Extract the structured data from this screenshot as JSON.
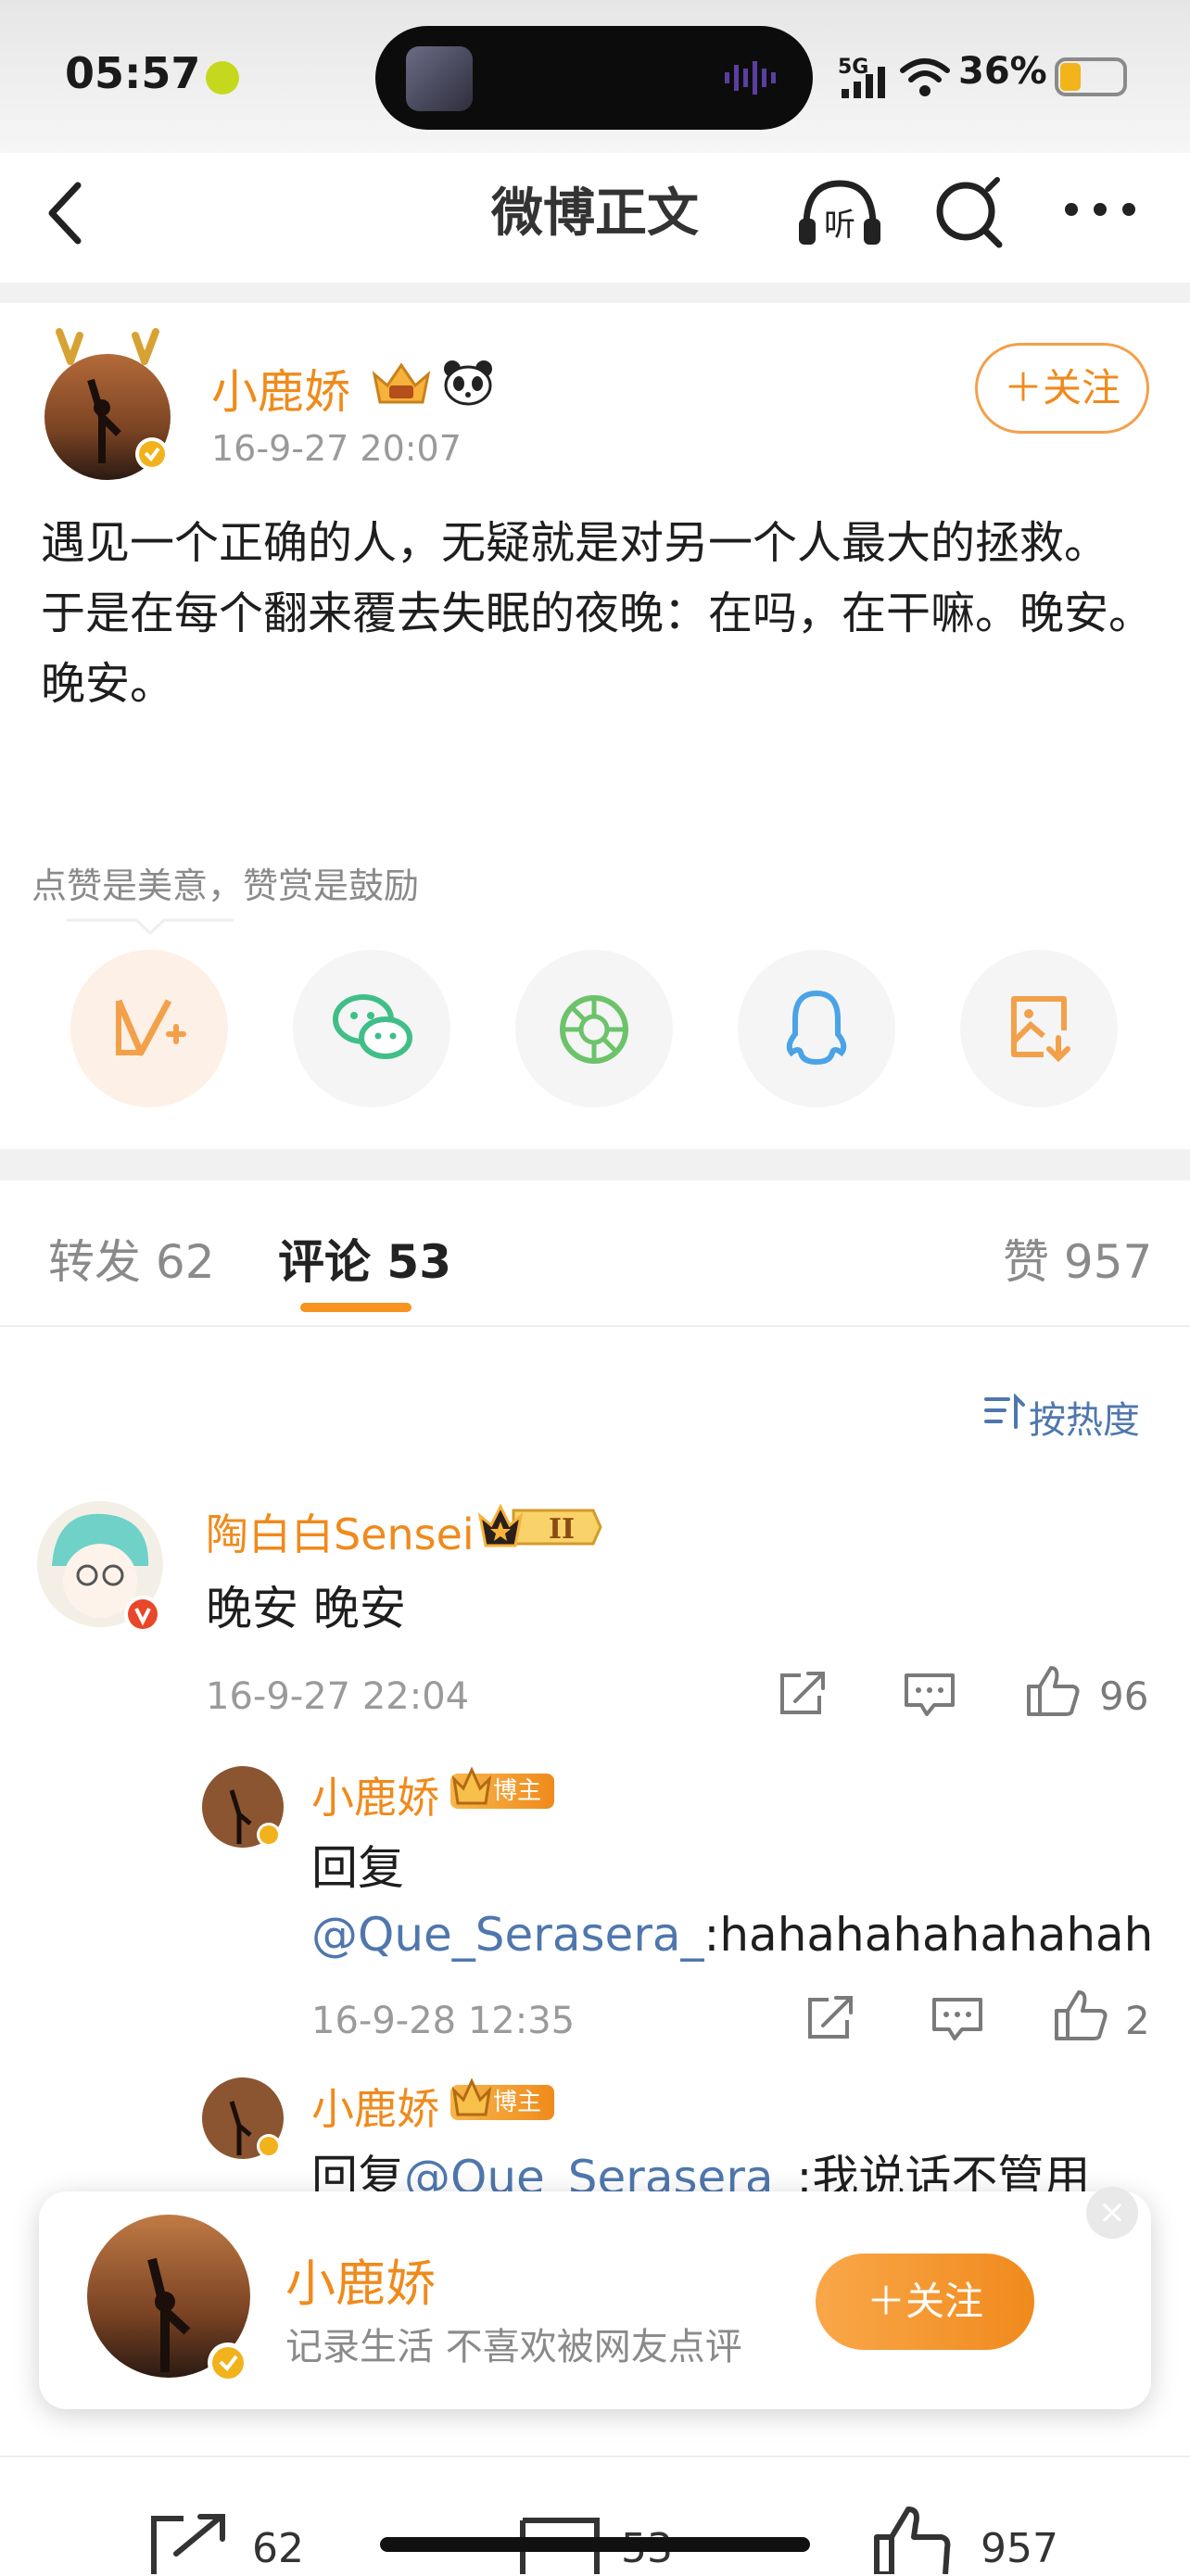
{
  "status_bar": {
    "time": "05:57",
    "network": "5G",
    "battery": "36%"
  },
  "nav": {
    "title": "微博正文"
  },
  "post": {
    "author": "小鹿娇",
    "time": "16-9-27 20:07",
    "follow_label": "＋关注",
    "text": "遇见一个正确的人，无疑就是对另一个人最大的拯救。\n于是在每个翻来覆去失眠的夜晚：在吗，在干嘛。晚安。晚安。",
    "tip": "点赞是美意，赞赏是鼓励"
  },
  "share_icons": [
    "reward-icon",
    "wechat-icon",
    "moments-icon",
    "qq-icon",
    "save-image-icon"
  ],
  "tabs": {
    "repost": "转发 62",
    "comment": "评论 53",
    "like": "赞 957"
  },
  "sort": {
    "label": "按热度"
  },
  "comments": [
    {
      "author": "陶白白Sensei",
      "text": "晚安 晚安",
      "time": "16-9-27 22:04",
      "likes": "96",
      "replies": [
        {
          "author": "小鹿娇",
          "badge": "博主",
          "prefix": "回复",
          "mention": "@Que_Serasera_",
          "text": ":hahahahahahahah",
          "time": "16-9-28 12:35",
          "likes": "2"
        },
        {
          "author": "小鹿娇",
          "badge": "博主",
          "prefix": "回复",
          "mention": "@Que_Serasera_",
          "text": ":我说话不管用"
        }
      ]
    }
  ],
  "popup": {
    "name": "小鹿娇",
    "desc": "记录生活 不喜欢被网友点评",
    "follow_label": "＋关注",
    "close_icon": "×"
  },
  "bottom_bar": {
    "repost_count": "62",
    "comment_count": "53",
    "like_count": "957"
  },
  "colors": {
    "accent": "#f08a1c",
    "link": "#4f77ad"
  }
}
